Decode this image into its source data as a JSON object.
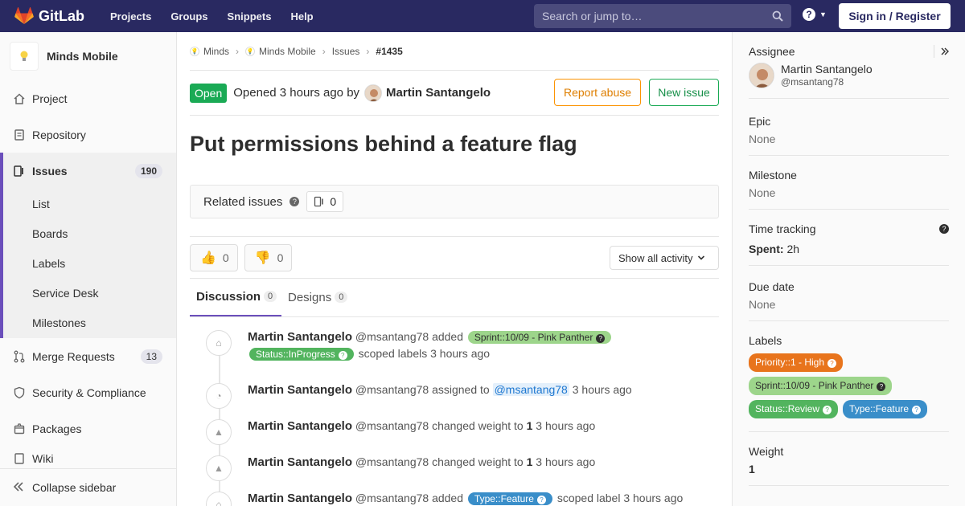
{
  "topnav": {
    "brand": "GitLab",
    "links": [
      "Projects",
      "Groups",
      "Snippets",
      "Help"
    ],
    "search_placeholder": "Search or jump to…",
    "signin": "Sign in / Register"
  },
  "sidebar": {
    "project_name": "Minds Mobile",
    "items": [
      {
        "label": "Project",
        "icon": "home-icon"
      },
      {
        "label": "Repository",
        "icon": "doc-icon"
      }
    ],
    "issues": {
      "label": "Issues",
      "count": "190",
      "sub": [
        "List",
        "Boards",
        "Labels",
        "Service Desk",
        "Milestones"
      ]
    },
    "items_after": [
      {
        "label": "Merge Requests",
        "count": "13",
        "icon": "merge-icon"
      },
      {
        "label": "Security & Compliance",
        "icon": "shield-icon"
      },
      {
        "label": "Packages",
        "icon": "package-icon"
      },
      {
        "label": "Wiki",
        "icon": "book-icon"
      }
    ],
    "collapse": "Collapse sidebar"
  },
  "breadcrumb": [
    "Minds",
    "Minds Mobile",
    "Issues",
    "#1435"
  ],
  "issue": {
    "status": "Open",
    "opened_text": "Opened 3 hours ago by",
    "author": "Martin Santangelo",
    "report_abuse": "Report abuse",
    "new_issue": "New issue",
    "title": "Put permissions behind a feature flag",
    "related_label": "Related issues",
    "related_count": "0",
    "thumbs_up": "0",
    "thumbs_down": "0",
    "activity_filter": "Show all activity",
    "tabs": [
      {
        "label": "Discussion",
        "count": "0"
      },
      {
        "label": "Designs",
        "count": "0"
      }
    ]
  },
  "notes": [
    {
      "who": "Martin Santangelo",
      "handle": "@msantang78",
      "pre": "added",
      "labels": [
        "Sprint::10/09 - Pink Panther",
        "Status::InProgress"
      ],
      "post": "scoped labels 3 hours ago"
    },
    {
      "who": "Martin Santangelo",
      "handle": "@msantang78",
      "pre": "assigned to",
      "mention": "@msantang78",
      "post": "3 hours ago"
    },
    {
      "who": "Martin Santangelo",
      "handle": "@msantang78",
      "pre": "changed weight to",
      "num": "1",
      "post": "3 hours ago"
    },
    {
      "who": "Martin Santangelo",
      "handle": "@msantang78",
      "pre": "changed weight to",
      "num": "1",
      "post": "3 hours ago"
    },
    {
      "who": "Martin Santangelo",
      "handle": "@msantang78",
      "pre": "added",
      "labels": [
        "Type::Feature"
      ],
      "post": "scoped label 3 hours ago"
    }
  ],
  "right": {
    "assignee_title": "Assignee",
    "assignee_name": "Martin Santangelo",
    "assignee_handle": "@msantang78",
    "epic_title": "Epic",
    "epic_value": "None",
    "milestone_title": "Milestone",
    "milestone_value": "None",
    "time_title": "Time tracking",
    "spent_label": "Spent:",
    "spent_value": "2h",
    "due_title": "Due date",
    "due_value": "None",
    "labels_title": "Labels",
    "labels": [
      {
        "text": "Priority::1 - High",
        "color": "#e8741c",
        "fg": "#ffffff"
      },
      {
        "text": "Sprint::10/09 - Pink Panther",
        "color": "#9dd58b",
        "fg": "#2e2e2e"
      },
      {
        "text": "Status::Review",
        "color": "#52b45e",
        "fg": "#ffffff"
      },
      {
        "text": "Type::Feature",
        "color": "#3a8ec9",
        "fg": "#ffffff"
      }
    ],
    "weight_title": "Weight",
    "weight_value": "1"
  },
  "colors": {
    "nav": "#292961",
    "status_open": "#1aaa55",
    "accent": "#6b4fbb"
  }
}
